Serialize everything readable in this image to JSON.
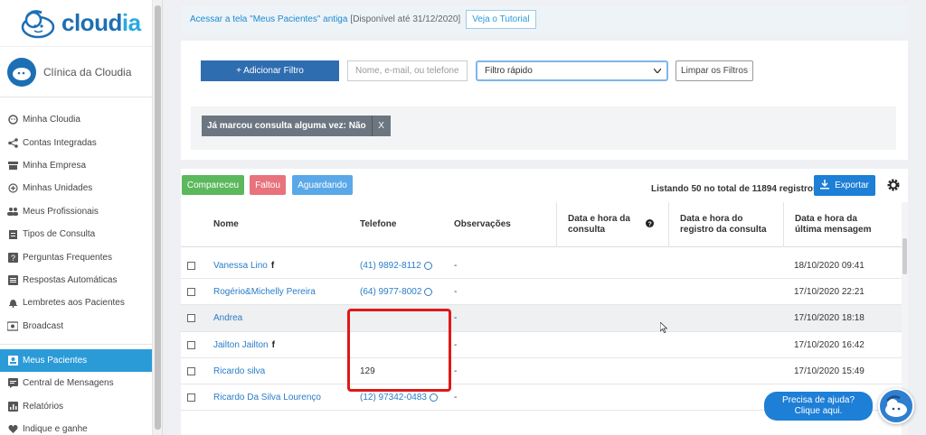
{
  "sidebar": {
    "logo_text": "cloud",
    "logo_accent": "ia",
    "clinic_name": "Clínica da Cloudia",
    "items": [
      {
        "label": "Minha Cloudia",
        "icon": "face-icon"
      },
      {
        "label": "Contas Integradas",
        "icon": "share-icon"
      },
      {
        "label": "Minha Empresa",
        "icon": "store-icon"
      },
      {
        "label": "Minhas Unidades",
        "icon": "plus-circle-icon"
      },
      {
        "label": "Meus Profissionais",
        "icon": "people-icon"
      },
      {
        "label": "Tipos de Consulta",
        "icon": "clipboard-icon"
      },
      {
        "label": "Perguntas Frequentes",
        "icon": "question-icon"
      },
      {
        "label": "Respostas Automáticas",
        "icon": "list-icon"
      },
      {
        "label": "Lembretes aos Pacientes",
        "icon": "bell-icon"
      },
      {
        "label": "Broadcast",
        "icon": "broadcast-icon"
      },
      {
        "label": "Meus Pacientes",
        "icon": "contact-icon"
      },
      {
        "label": "Central de Mensagens",
        "icon": "message-icon"
      },
      {
        "label": "Relatórios",
        "icon": "chart-icon"
      },
      {
        "label": "Indique e ganhe",
        "icon": "heart-icon"
      }
    ]
  },
  "banner": {
    "link": "Acessar a tela \"Meus Pacientes\" antiga",
    "note": "[Disponível até 31/12/2020]",
    "tutorial": "Veja o Tutorial"
  },
  "filters": {
    "add_label": "+ Adicionar Filtro",
    "search_placeholder": "Nome, e-mail, ou telefone",
    "quick_filter": "Filtro rápido",
    "clear_label": "Limpar os Filtros",
    "active_chip": "Já marcou consulta alguma vez: Não",
    "chip_close": "X"
  },
  "list": {
    "status_buttons": [
      "Compareceu",
      "Faltou",
      "Aguardando"
    ],
    "count_text": "Listando 50 no total de 11894 registros",
    "export_label": "Exportar",
    "columns": {
      "name": "Nome",
      "phone": "Telefone",
      "obs": "Observações",
      "appt": "Data e hora da consulta",
      "registered": "Data e hora do registro da consulta",
      "last_msg": "Data e hora da última mensagem"
    },
    "rows": [
      {
        "name": "Vanessa Lino",
        "fb": true,
        "phone": "(41) 9892-8112",
        "wa": true,
        "obs": "-",
        "last_msg": "18/10/2020 09:41"
      },
      {
        "name": "Rogério&Michelly Pereira",
        "fb": false,
        "phone": "(64) 9977-8002",
        "wa": true,
        "obs": "-",
        "last_msg": "17/10/2020 22:21"
      },
      {
        "name": "Andrea",
        "fb": false,
        "phone": "",
        "wa": false,
        "obs": "-",
        "last_msg": "17/10/2020 18:18"
      },
      {
        "name": "Jailton Jailton",
        "fb": true,
        "phone": "",
        "wa": false,
        "obs": "-",
        "last_msg": "17/10/2020 16:42"
      },
      {
        "name": "Ricardo silva",
        "fb": false,
        "phone": "129",
        "wa": false,
        "obs": "-",
        "last_msg": "17/10/2020 15:49"
      },
      {
        "name": "Ricardo Da Silva Lourenço",
        "fb": false,
        "phone": "(12) 97342-0483",
        "wa": true,
        "obs": "-",
        "last_msg": ""
      }
    ]
  },
  "help": {
    "text": "Precisa de ajuda? Clique aqui."
  },
  "colors": {
    "primary": "#2e6db0",
    "active_menu": "#2b9bd8",
    "came": "#5cb85c",
    "missed": "#e8737c",
    "waiting": "#5ba8e8",
    "highlight_box": "#e01818"
  }
}
